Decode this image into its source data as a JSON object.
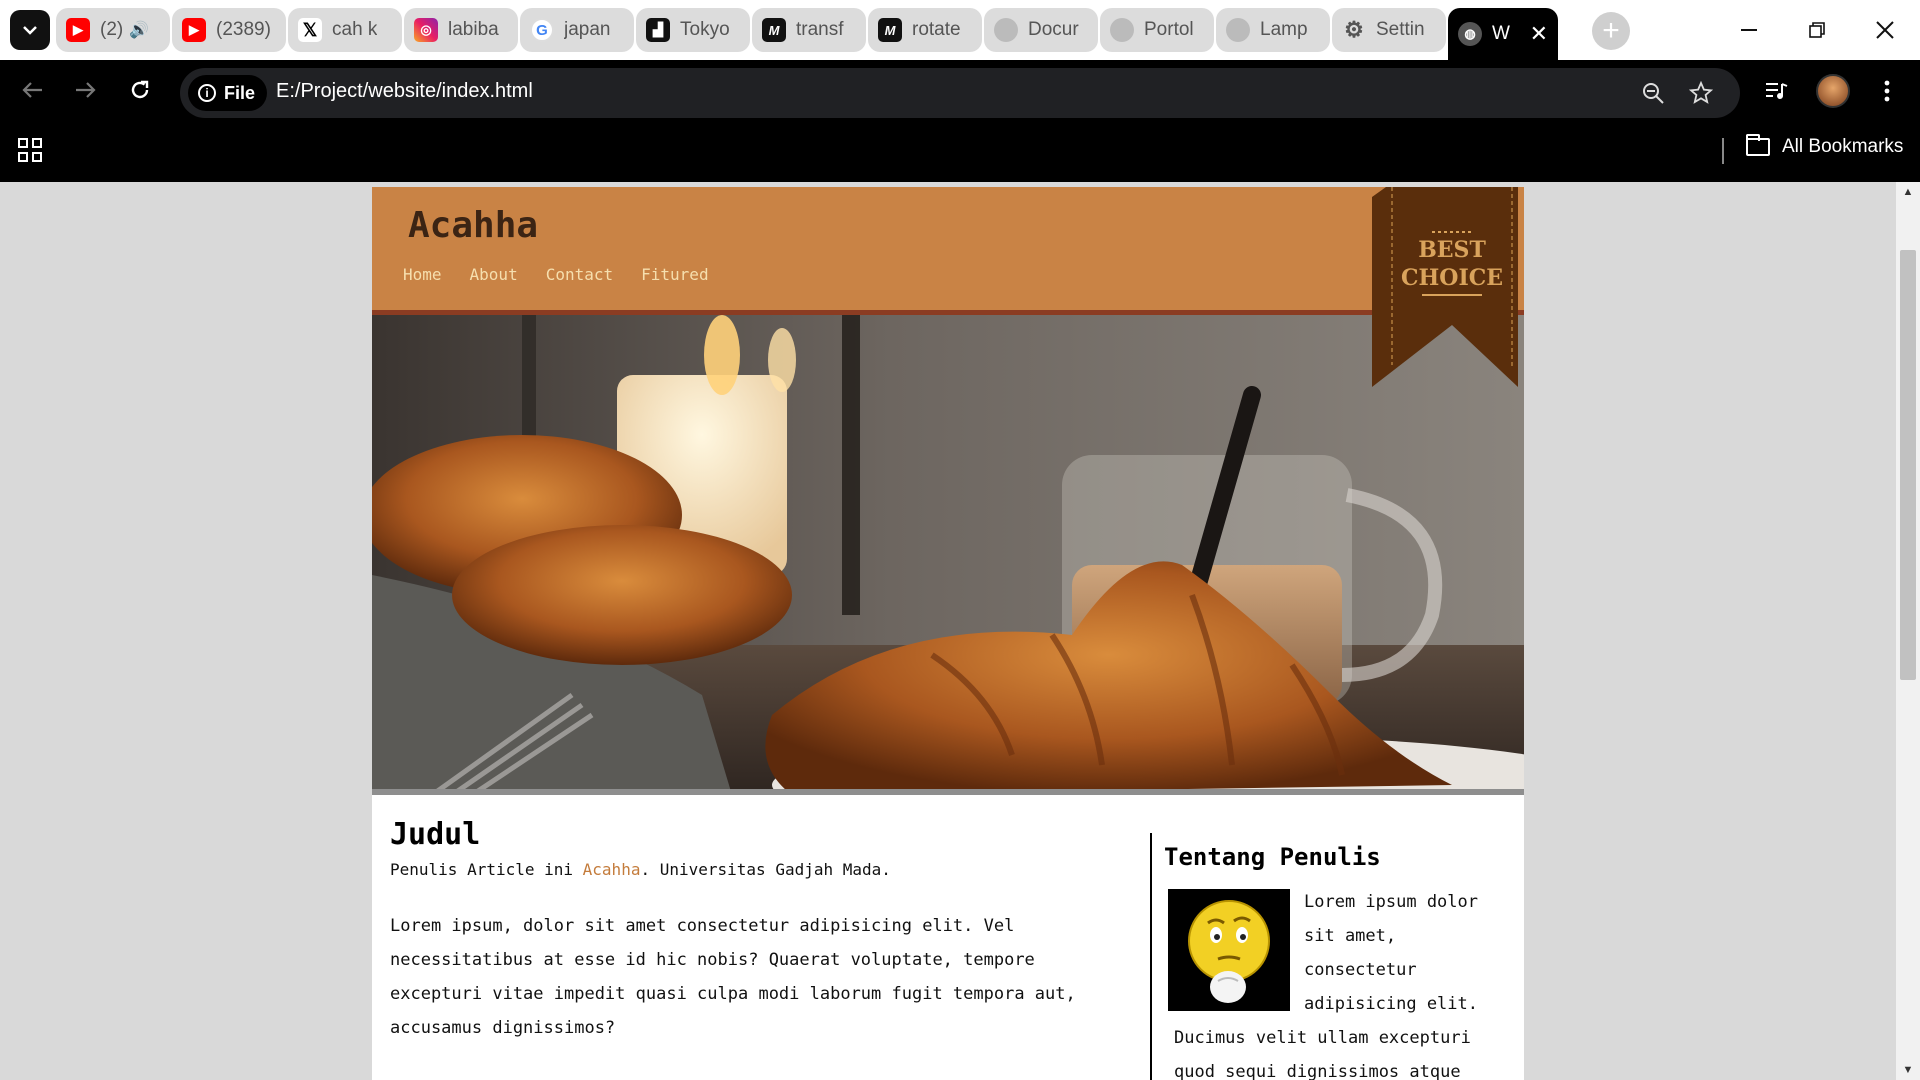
{
  "browser": {
    "tabs": [
      {
        "title": "(2)",
        "icon": "youtube-icon",
        "audio": true
      },
      {
        "title": "(2389)",
        "icon": "youtube-icon"
      },
      {
        "title": "cah k",
        "icon": "x-icon"
      },
      {
        "title": "labiba",
        "icon": "instagram-icon"
      },
      {
        "title": "japan",
        "icon": "google-icon"
      },
      {
        "title": "Tokyo",
        "icon": "unsplash-icon"
      },
      {
        "title": "transf",
        "icon": "medium-icon"
      },
      {
        "title": "rotate",
        "icon": "medium-icon"
      },
      {
        "title": "Docur",
        "icon": "globe-icon"
      },
      {
        "title": "Portol",
        "icon": "globe-icon"
      },
      {
        "title": "Lamp",
        "icon": "globe-icon"
      },
      {
        "title": "Settin",
        "icon": "gear-icon"
      },
      {
        "title": "W",
        "icon": "globe-icon",
        "active": true
      }
    ],
    "new_tab_symbol": "+",
    "site_chip": "File",
    "url": "E:/Project/website/index.html",
    "bookmarks_label": "All Bookmarks"
  },
  "site": {
    "brand": "Acahha",
    "nav": [
      "Home",
      "About",
      "Contact",
      "Fitured"
    ],
    "ribbon": {
      "line1": "BEST",
      "line2": "CHOICE"
    },
    "article": {
      "title": "Judul",
      "byline_prefix": "Penulis Article ini ",
      "byline_author": "Acahha",
      "byline_suffix": ". Universitas Gadjah Mada.",
      "body": "Lorem ipsum, dolor sit amet consectetur adipisicing elit. Vel necessitatibus at esse id hic nobis? Quaerat voluptate, tempore excepturi vitae impedit quasi culpa modi laborum fugit tempora aut, accusamus dignissimos?"
    },
    "sidebar": {
      "title": "Tentang Penulis",
      "body": "Lorem ipsum dolor sit amet, consectetur adipisicing elit. Ducimus velit ullam excepturi quod sequi dignissimos atque"
    }
  },
  "colors": {
    "header": "#c98345",
    "brand_text": "#3b2414",
    "nav_text": "#f6dfae",
    "ribbon": "#5a2e0c",
    "author_link": "#c47c3c"
  }
}
